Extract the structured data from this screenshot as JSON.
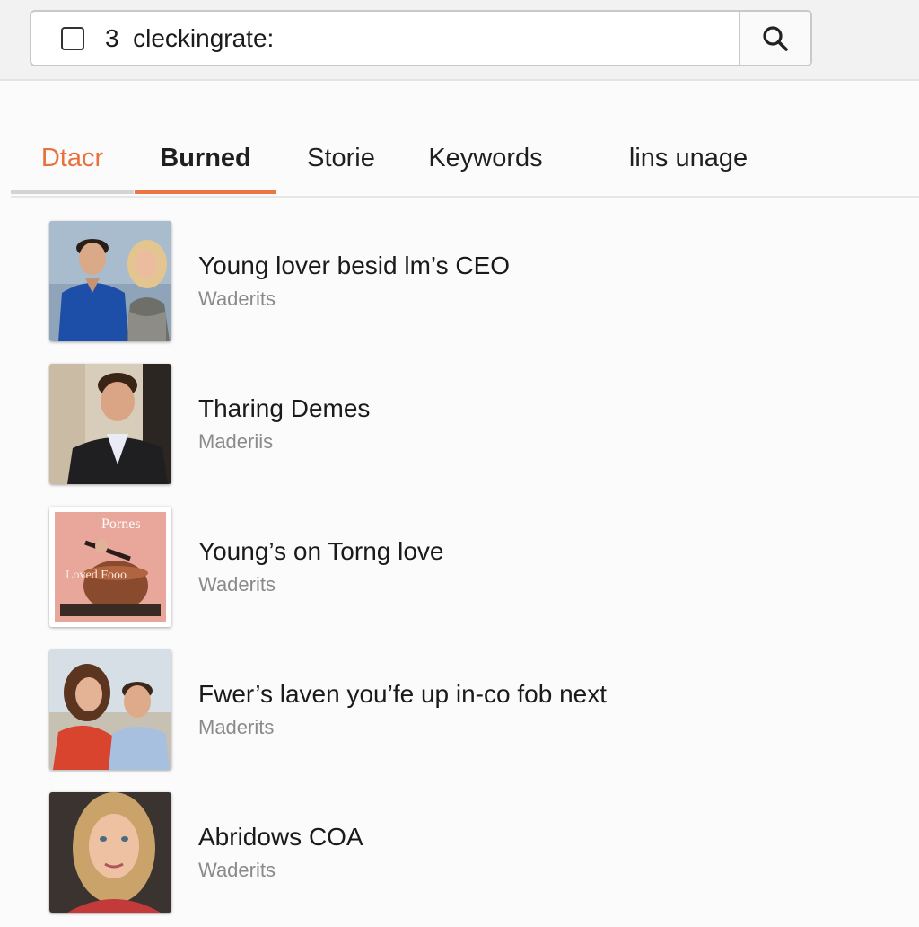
{
  "search": {
    "value": "3  cleckingrate:",
    "button_icon": "search-icon",
    "checkbox_checked": false
  },
  "tabs": [
    {
      "label": "Dtacr"
    },
    {
      "label": "Burned",
      "active": true
    },
    {
      "label": "Storie"
    },
    {
      "label": "Keywords"
    },
    {
      "label": "lins unage"
    }
  ],
  "colors": {
    "accent": "#ee7442",
    "first_tab_text": "#e8713c"
  },
  "items": [
    {
      "title": "Young lover besid lm’s CEO",
      "subtitle": "Waderits",
      "thumb": "couple-photo"
    },
    {
      "title": "Tharing Demes",
      "subtitle": "Maderiis",
      "thumb": "man-in-suit-photo"
    },
    {
      "title": "Young’s on Torng love",
      "subtitle": "Waderits",
      "thumb": "book-cover",
      "cover_text": {
        "top": "Pornes",
        "middle": "Loved Fooo"
      }
    },
    {
      "title": "Fwer’s laven you’fe up in-co fob next",
      "subtitle": "Maderits",
      "thumb": "couple-photo"
    },
    {
      "title": "Abridows COA",
      "subtitle": "Waderits",
      "thumb": "woman-portrait-photo"
    }
  ]
}
